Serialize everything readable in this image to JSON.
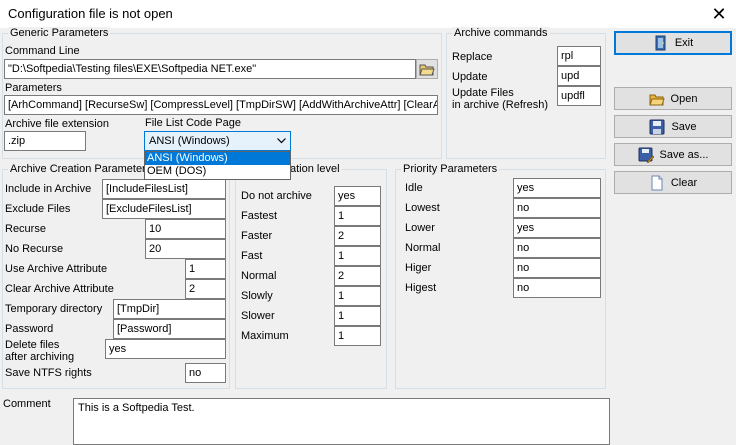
{
  "window": {
    "title": "Configuration file is not open",
    "close_glyph": "✕"
  },
  "generic": {
    "legend": "Generic Parameters",
    "command_line_label": "Command Line",
    "command_line_value": "\"D:\\Softpedia\\Testing files\\EXE\\Softpedia NET.exe\"",
    "parameters_label": "Parameters",
    "parameters_value": "[ArhCommand] [RecurseSw] [CompressLevel] [TmpDirSW] [AddWithArchiveAttr] [ClearArch",
    "ext_label": "Archive file extension",
    "ext_value": ".zip",
    "codepage_label": "File List Code Page",
    "codepage_value": "ANSI (Windows)",
    "codepage_options": [
      "ANSI (Windows)",
      "OEM (DOS)"
    ]
  },
  "archive_commands": {
    "legend": "Archive commands",
    "replace_label": "Replace",
    "replace_value": "rpl",
    "update_label": "Update",
    "update_value": "upd",
    "update_files_label1": "Update Files",
    "update_files_label2": "in archive (Refresh)",
    "update_files_value": "updfl"
  },
  "creation": {
    "legend": "Archive Creation Parameters",
    "include_label": "Include in Archive",
    "include_value": "[IncludeFilesList]",
    "exclude_label": "Exclude Files",
    "exclude_value": "[ExcludeFilesList]",
    "recurse_label": "Recurse",
    "recurse_value": "10",
    "norecurse_label": "No Recurse",
    "norecurse_value": "20",
    "use_attr_label": "Use Archive Attribute",
    "use_attr_value": "1",
    "clear_attr_label": "Clear Archive Attribute",
    "clear_attr_value": "2",
    "tempdir_label": "Temporary directory",
    "tempdir_value": "[TmpDir]",
    "password_label": "Password",
    "password_value": "[Password]",
    "delete_label1": "Delete files",
    "delete_label2": "after archiving",
    "delete_value": "yes",
    "ntfs_label": "Save NTFS rights",
    "ntfs_value": "no"
  },
  "compression": {
    "legend": "ation level",
    "rows": [
      {
        "label": "Do not archive",
        "value": "yes"
      },
      {
        "label": "Fastest",
        "value": "1"
      },
      {
        "label": "Faster",
        "value": "2"
      },
      {
        "label": "Fast",
        "value": "1"
      },
      {
        "label": "Normal",
        "value": "2"
      },
      {
        "label": "Slowly",
        "value": "1"
      },
      {
        "label": "Slower",
        "value": "1"
      },
      {
        "label": "Maximum",
        "value": "1"
      }
    ]
  },
  "priority": {
    "legend": "Priority Parameters",
    "rows": [
      {
        "label": "Idle",
        "value": "yes"
      },
      {
        "label": "Lowest",
        "value": "no"
      },
      {
        "label": "Lower",
        "value": "yes"
      },
      {
        "label": "Normal",
        "value": "no"
      },
      {
        "label": "Higer",
        "value": "no"
      },
      {
        "label": "Higest",
        "value": "no"
      }
    ]
  },
  "comment": {
    "label": "Comment",
    "value": "This is a Softpedia Test."
  },
  "buttons": {
    "exit": "Exit",
    "open": "Open",
    "save": "Save",
    "save_as": "Save as...",
    "clear": "Clear"
  },
  "icons": {
    "exit": "exit-door-icon",
    "open": "open-folder-icon",
    "save": "save-disk-icon",
    "save_as": "save-as-icon",
    "clear": "clear-page-icon",
    "browse": "browse-folder-icon"
  }
}
